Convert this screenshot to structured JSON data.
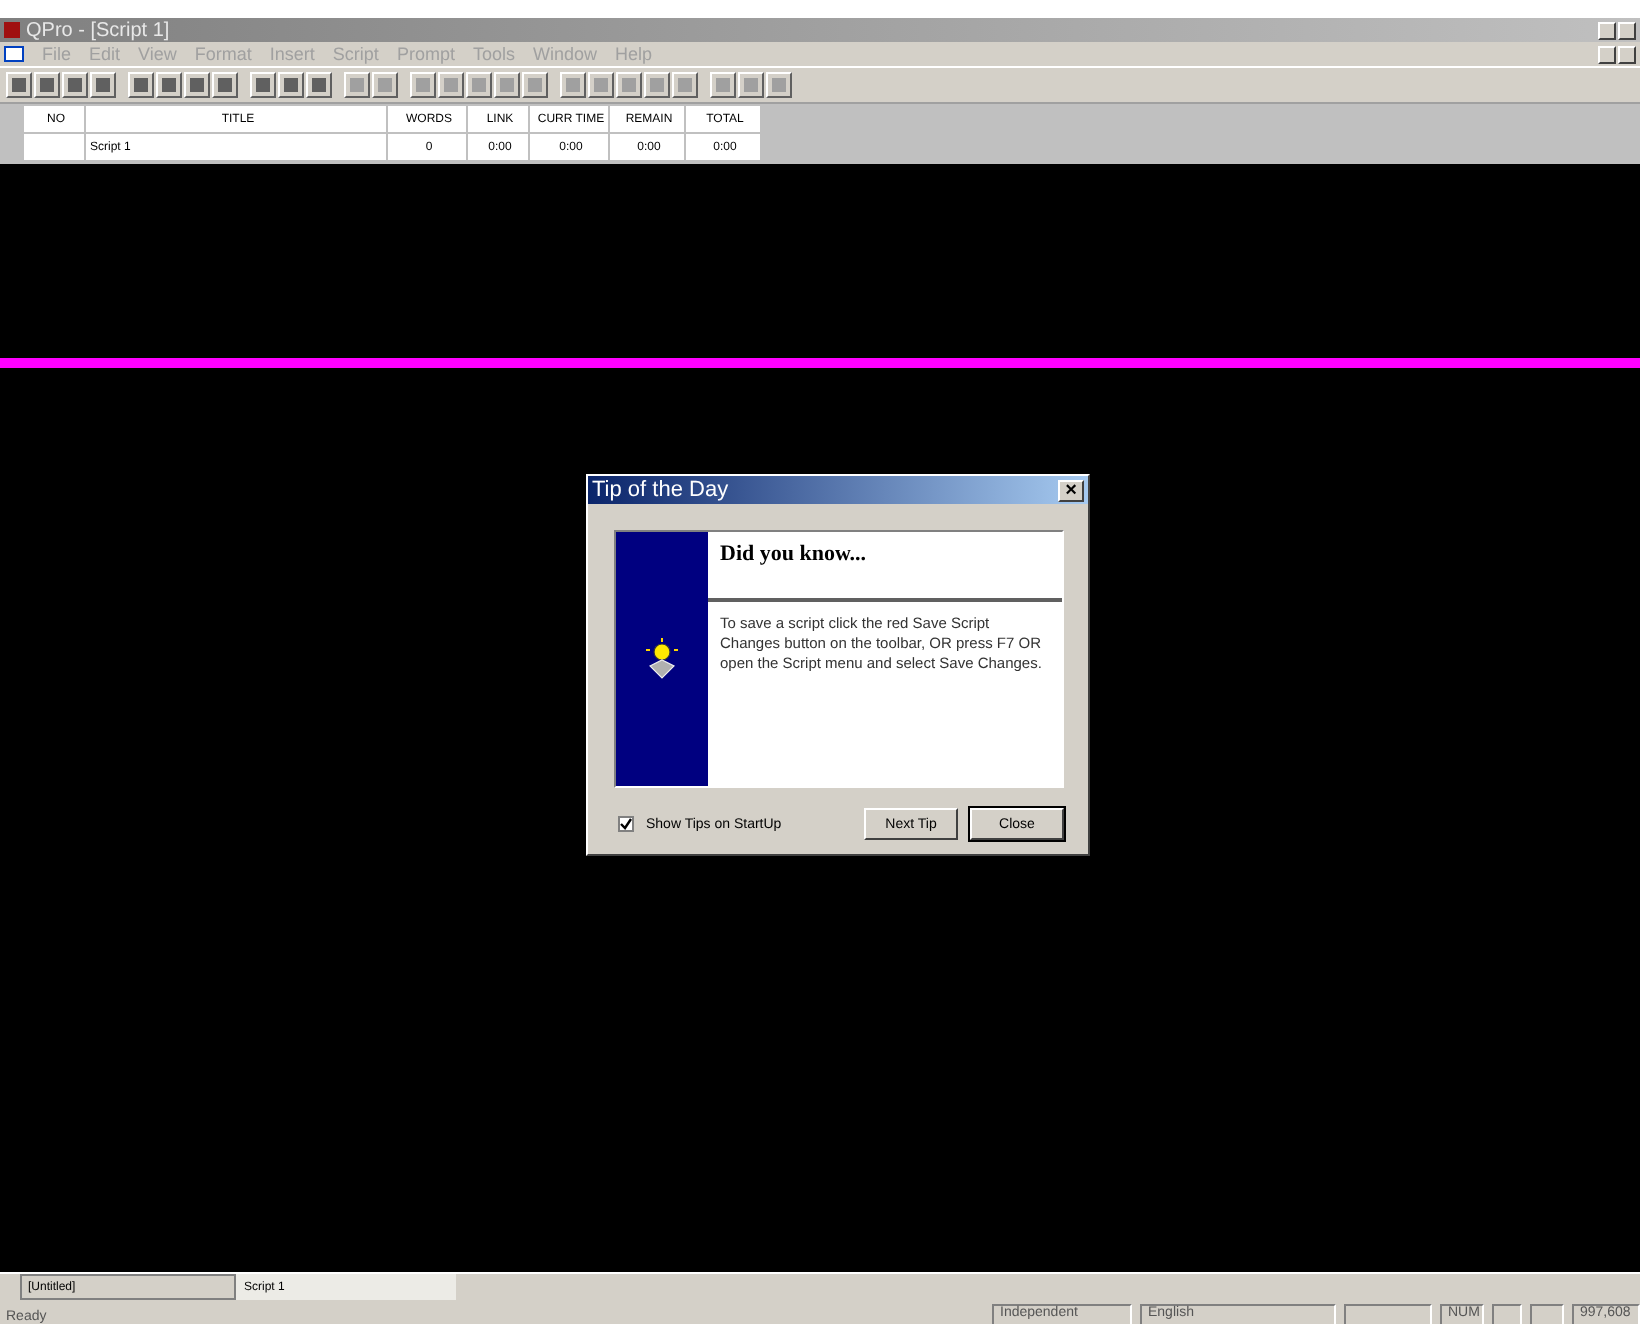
{
  "window": {
    "title": "QPro - [Script 1]"
  },
  "menu": [
    "File",
    "Edit",
    "View",
    "Format",
    "Insert",
    "Script",
    "Prompt",
    "Tools",
    "Window",
    "Help"
  ],
  "table": {
    "columns": [
      "NO",
      "TITLE",
      "WORDS",
      "LINK",
      "CURR TIME",
      "REMAIN",
      "TOTAL"
    ],
    "rows": [
      [
        "",
        "Script 1",
        "0",
        "0:00",
        "0:00",
        "0:00",
        "0:00"
      ]
    ]
  },
  "dialog": {
    "title": "Tip of the Day",
    "close": "×",
    "heading": "Did you know...",
    "tip": "To save a script click the red Save Script Changes button on the toolbar, OR press F7 OR open the Script menu and select Save Changes.",
    "show_tips": {
      "label": "Show Tips on StartUp",
      "checked": true
    },
    "buttons": [
      "Next Tip",
      "Close"
    ]
  },
  "doc_tabs": [
    {
      "label": "[Untitled]",
      "selected": false
    },
    {
      "label": "Script 1",
      "selected": true
    }
  ],
  "status_bar": {
    "message": "Ready",
    "panels": [
      {
        "kind": "text",
        "text": "Independent"
      },
      {
        "kind": "text",
        "text": "English"
      },
      {
        "kind": "blank"
      },
      {
        "kind": "text",
        "text": "NUM"
      },
      {
        "kind": "blank"
      },
      {
        "kind": "blank"
      },
      {
        "kind": "text",
        "text": "997,608"
      }
    ]
  }
}
